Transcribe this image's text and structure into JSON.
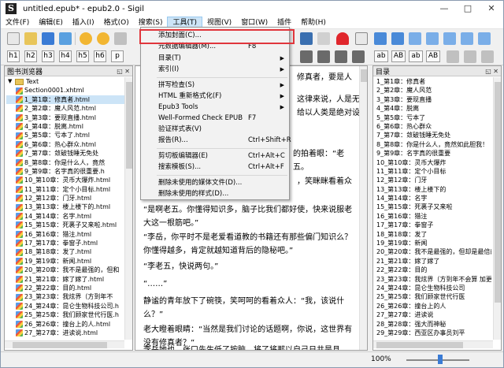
{
  "window": {
    "title": "untitled.epub* - epub2.0 - Sigil",
    "app_icon": "S",
    "minimize": "—",
    "maximize": "□",
    "close": "✕"
  },
  "menubar": {
    "items": [
      "文件(F)",
      "编辑(E)",
      "插入(I)",
      "格式(O)",
      "搜索(S)",
      "工具(T)",
      "视图(V)",
      "窗口(W)",
      "插件",
      "帮助(H)"
    ]
  },
  "heading_buttons": [
    "h1",
    "h2",
    "h3",
    "h4",
    "h5",
    "h6",
    "p"
  ],
  "right_toolbar_buttons": [
    "ab",
    "AB",
    "ab",
    "AB"
  ],
  "left_panel": {
    "title": "图书浏览器",
    "folder": "Text",
    "files": [
      "Section0001.xhtml",
      "1_第1章：修真者.html",
      "2_第2章：魔人风范.html",
      "3_第3章：要现直播.html",
      "4_第4章：脱离.html",
      "5_第5章：亏本了.html",
      "6_第6章：热心群众.html",
      "7_第7章：敛破钱睡无免处",
      "8_第8章：你是什么人，竟然",
      "9_第9章：名字真的很重要.h",
      "10_第10章：灵币大爆炸.html",
      "11_第11章：定个小目标.html",
      "12_第12章：门牙.html",
      "13_第13章：楼上楼下的.html",
      "14_第14章：名字.html",
      "15_第15章：死裹子又来啦.html",
      "16_第16章：猎注.html",
      "17_第17章：拳窗子.html",
      "18_第18章：发了.html",
      "19_第19章：新闻.html",
      "20_第20章：我不是最强的，但和",
      "21_第21章：嫁了嫁了.html",
      "22_第22章：目的.html",
      "23_第23章：我炫界（方到年不",
      "24_第24章：昆仑生物科技公司.h",
      "25_第25章：我们顾家世代行医.h",
      "26_第26章：撞台上的人.html",
      "27_第27章：进读说.html"
    ]
  },
  "right_panel": {
    "title": "目录",
    "items": [
      "1_第1章：修真者",
      "2_第2章：魔人风范",
      "3_第3章：要现直播",
      "4_第4章：脱离",
      "5_第5章：亏本了",
      "6_第6章：热心群众",
      "7_第7章：敛破钱睡无免处",
      "8_第8章：你是什么人，竟然如此胆我！",
      "9_第9章：名字真的很重要",
      "10_第10章：灵币大爆炸",
      "11_第11章：定个小目标",
      "12_第12章：门牙",
      "13_第13章：楼上楼下的",
      "14_第14章：名字",
      "15_第15章：死裹子又来啦",
      "16_第16章：猎注",
      "17_第17章：拳窗子",
      "18_第18章：发了",
      "19_第19章：新闻",
      "20_第20章：我不是最强的，但却是最倍的",
      "21_第21章：嫁了嫁了",
      "22_第22章：目的",
      "23_第23章：我炫界（方到年不会算 加更）",
      "24_第24章：昆仑生物科技公司",
      "25_第25章：我们顾家世代行医",
      "26_第26章：撞台上的人",
      "27_第27章：进读说",
      "28_第28章：强大而神秘",
      "29_第29章：西亚区办事员刘平"
    ]
  },
  "editor": {
    "paragraphs": [
      "修真者，要是人",
      "这律来说，人是无",
      "给以人类是绝对设",
      "的拍着眼：“老五。",
      "，笑眯眯看着众",
      "“是啊老五。你懂得知识多，脑子比我们都好使，快来说服老大这一根筋吧。”",
      "“李岳，你平时不是老爱看道教的书籍还有那些偏门知识么？你懂得越多，肯定就越知道背后的隐秘吧。”",
      "“李老五，快说两句。”",
      "“……”",
      "静谧的青年放下了碗筷，笑呵呵的看着众人：“我，该说什么？”",
      "老大瞪着眼睛：“当然是我们讨论的话题啊，你说，这世界有没有修真者？”",
      "李岳她也，张口先生低了按脑，将了将那以自己日共是县"
    ]
  },
  "tools_menu": {
    "items": [
      {
        "label": "添加封面(C)...",
        "shortcut": "",
        "submenu": false
      },
      {
        "label": "元数据编辑器(M)...",
        "shortcut": "F8",
        "submenu": false
      },
      {
        "label": "目录(T)",
        "shortcut": "",
        "submenu": true
      },
      {
        "label": "索引(I)",
        "shortcut": "",
        "submenu": true
      },
      {
        "label": "拼写检查(S)",
        "shortcut": "",
        "submenu": true
      },
      {
        "label": "HTML 重新格式化(F)",
        "shortcut": "",
        "submenu": true
      },
      {
        "label": "Epub3 Tools",
        "shortcut": "",
        "submenu": true
      },
      {
        "label": "Well-Formed Check EPUB",
        "shortcut": "F7",
        "submenu": false
      },
      {
        "label": "验证样式表(V)",
        "shortcut": "",
        "submenu": false
      },
      {
        "label": "报告(R)...",
        "shortcut": "Ctrl+Shift+R",
        "submenu": false
      },
      {
        "label": "剪切板编辑器(E)",
        "shortcut": "Ctrl+Alt+C",
        "submenu": false
      },
      {
        "label": "搜索模板(S)...",
        "shortcut": "Ctrl+Alt+F",
        "submenu": false
      },
      {
        "label": "删除未使用的媒体文件(D)...",
        "shortcut": "",
        "submenu": false
      },
      {
        "label": "删除未使用的样式(D)...",
        "shortcut": "",
        "submenu": false
      }
    ]
  },
  "status": {
    "zoom": "100%"
  }
}
